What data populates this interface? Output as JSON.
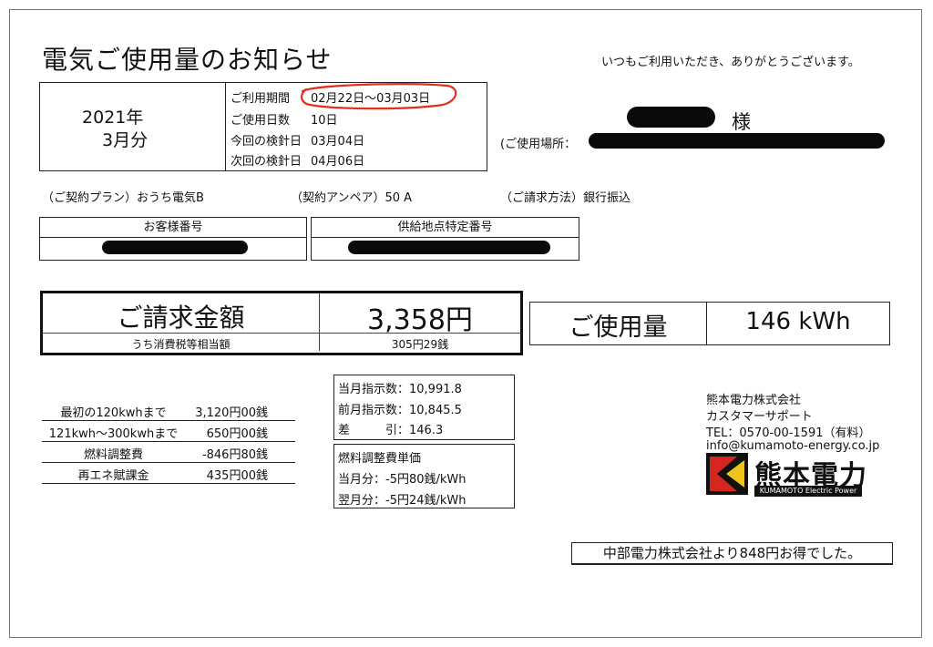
{
  "header": {
    "title": "電気ご使用量のお知らせ",
    "greeting": "いつもご利用いただき、ありがとうございます。"
  },
  "billing_period": {
    "year": "2021年",
    "month": "3月分",
    "rows": [
      {
        "label": "ご利用期間",
        "value": "02月22日〜03月03日"
      },
      {
        "label": "ご使用日数",
        "value": "10日"
      },
      {
        "label": "今回の検針日",
        "value": "03月04日"
      },
      {
        "label": "次回の検針日",
        "value": "04月06日"
      }
    ]
  },
  "customer": {
    "honorific": "様",
    "location_label": "(ご使用場所："
  },
  "contract": {
    "plan": "（ご契約プラン）おうち電気B",
    "ampere": "（契約アンペア）50 A",
    "payment": "（ご請求方法）銀行振込"
  },
  "ids": {
    "customer_number_label": "お客様番号",
    "supply_point_label": "供給地点特定番号"
  },
  "billing": {
    "label": "ご請求金額",
    "amount": "3,358円",
    "tax_label": "うち消費税等相当額",
    "tax_amount": "305円29銭"
  },
  "usage": {
    "label": "ご使用量",
    "value": "146 kWh"
  },
  "charges": [
    {
      "label": "最初の120kwhまで",
      "value": "3,120円00銭"
    },
    {
      "label": "121kwh〜300kwhまで",
      "value": "650円00銭"
    },
    {
      "label": "燃料調整費",
      "value": "-846円80銭"
    },
    {
      "label": "再エネ賦課金",
      "value": "435円00銭"
    }
  ],
  "meter": {
    "current": "当月指示数：10,991.8",
    "previous": "前月指示数：10,845.5",
    "difference_label": "差　　　引：146.3"
  },
  "fuel_adjustment": {
    "title": "燃料調整費単価",
    "this_month": "当月分：-5円80銭/kWh",
    "next_month": "翌月分：-5円24銭/kWh"
  },
  "company": {
    "name": "熊本電力株式会社",
    "dept": "カスタマーサポート",
    "tel": "TEL：0570-00-1591（有料）",
    "email": "info@kumamoto-energy.co.jp",
    "logo_text": "熊本電力",
    "logo_sub": "KUMAMOTO Electric Power",
    "logo_colors": {
      "red": "#d7261e",
      "yellow": "#f0c419",
      "black": "#111111"
    }
  },
  "savings_note": "中部電力株式会社より848円お得でした。",
  "annotation_color": "#e0301e"
}
